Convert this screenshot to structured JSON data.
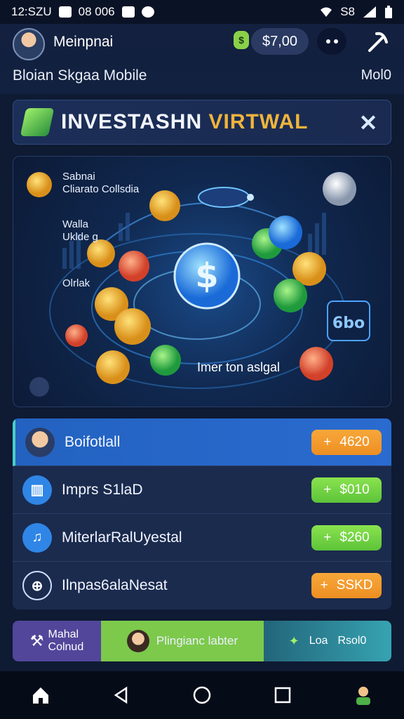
{
  "status_bar": {
    "time": "12:SZU",
    "notif1": "08 006",
    "right_text": "S8"
  },
  "header": {
    "username": "Meinpnai",
    "coin_badge": "$",
    "balance": "$7,00",
    "subtitle": "Bloian Skgaa Mobile",
    "link": "Mol0"
  },
  "banner": {
    "title_part1": "INVESTASHN",
    "title_part2": "VIRTWAL"
  },
  "hero": {
    "label1_line1": "Sabnai",
    "label1_line2": "Cliarato Collsdia",
    "label2_line1": "Walla",
    "label2_line2": "Uklde g",
    "label3": "Olrlak",
    "caption": "Imer ton aslgal",
    "cube_text": "6bo"
  },
  "list": [
    {
      "label": "Boifotlall",
      "amount": "4620",
      "symbol": "+",
      "color": "orange",
      "icon": "avatar-icon"
    },
    {
      "label": "Imprs S1laD",
      "amount": "$010",
      "symbol": "+",
      "color": "green",
      "icon": "chart-icon"
    },
    {
      "label": "MiterlarRalUyestal",
      "amount": "$260",
      "symbol": "+",
      "color": "green",
      "icon": "music-icon"
    },
    {
      "label": "Ilnpas6alaNesat",
      "amount": "SSKD",
      "symbol": "+",
      "color": "orange",
      "icon": "target-icon"
    }
  ],
  "tabs": {
    "tab1_line1": "Mahal",
    "tab1_line2": "Colnud",
    "tab2": "Plingianc labter",
    "tab3_a": "Loa",
    "tab3_b": "Rsol0"
  }
}
